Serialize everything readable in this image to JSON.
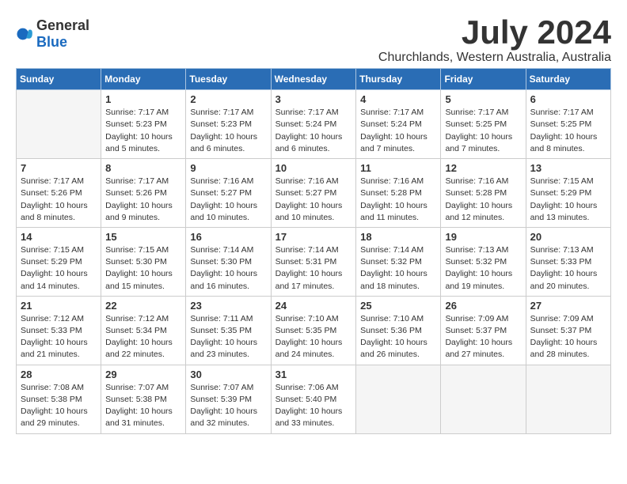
{
  "header": {
    "logo_general": "General",
    "logo_blue": "Blue",
    "title": "July 2024",
    "location": "Churchlands, Western Australia, Australia"
  },
  "weekdays": [
    "Sunday",
    "Monday",
    "Tuesday",
    "Wednesday",
    "Thursday",
    "Friday",
    "Saturday"
  ],
  "weeks": [
    [
      {
        "day": "",
        "info": ""
      },
      {
        "day": "1",
        "info": "Sunrise: 7:17 AM\nSunset: 5:23 PM\nDaylight: 10 hours\nand 5 minutes."
      },
      {
        "day": "2",
        "info": "Sunrise: 7:17 AM\nSunset: 5:23 PM\nDaylight: 10 hours\nand 6 minutes."
      },
      {
        "day": "3",
        "info": "Sunrise: 7:17 AM\nSunset: 5:24 PM\nDaylight: 10 hours\nand 6 minutes."
      },
      {
        "day": "4",
        "info": "Sunrise: 7:17 AM\nSunset: 5:24 PM\nDaylight: 10 hours\nand 7 minutes."
      },
      {
        "day": "5",
        "info": "Sunrise: 7:17 AM\nSunset: 5:25 PM\nDaylight: 10 hours\nand 7 minutes."
      },
      {
        "day": "6",
        "info": "Sunrise: 7:17 AM\nSunset: 5:25 PM\nDaylight: 10 hours\nand 8 minutes."
      }
    ],
    [
      {
        "day": "7",
        "info": "Sunrise: 7:17 AM\nSunset: 5:26 PM\nDaylight: 10 hours\nand 8 minutes."
      },
      {
        "day": "8",
        "info": "Sunrise: 7:17 AM\nSunset: 5:26 PM\nDaylight: 10 hours\nand 9 minutes."
      },
      {
        "day": "9",
        "info": "Sunrise: 7:16 AM\nSunset: 5:27 PM\nDaylight: 10 hours\nand 10 minutes."
      },
      {
        "day": "10",
        "info": "Sunrise: 7:16 AM\nSunset: 5:27 PM\nDaylight: 10 hours\nand 10 minutes."
      },
      {
        "day": "11",
        "info": "Sunrise: 7:16 AM\nSunset: 5:28 PM\nDaylight: 10 hours\nand 11 minutes."
      },
      {
        "day": "12",
        "info": "Sunrise: 7:16 AM\nSunset: 5:28 PM\nDaylight: 10 hours\nand 12 minutes."
      },
      {
        "day": "13",
        "info": "Sunrise: 7:15 AM\nSunset: 5:29 PM\nDaylight: 10 hours\nand 13 minutes."
      }
    ],
    [
      {
        "day": "14",
        "info": "Sunrise: 7:15 AM\nSunset: 5:29 PM\nDaylight: 10 hours\nand 14 minutes."
      },
      {
        "day": "15",
        "info": "Sunrise: 7:15 AM\nSunset: 5:30 PM\nDaylight: 10 hours\nand 15 minutes."
      },
      {
        "day": "16",
        "info": "Sunrise: 7:14 AM\nSunset: 5:30 PM\nDaylight: 10 hours\nand 16 minutes."
      },
      {
        "day": "17",
        "info": "Sunrise: 7:14 AM\nSunset: 5:31 PM\nDaylight: 10 hours\nand 17 minutes."
      },
      {
        "day": "18",
        "info": "Sunrise: 7:14 AM\nSunset: 5:32 PM\nDaylight: 10 hours\nand 18 minutes."
      },
      {
        "day": "19",
        "info": "Sunrise: 7:13 AM\nSunset: 5:32 PM\nDaylight: 10 hours\nand 19 minutes."
      },
      {
        "day": "20",
        "info": "Sunrise: 7:13 AM\nSunset: 5:33 PM\nDaylight: 10 hours\nand 20 minutes."
      }
    ],
    [
      {
        "day": "21",
        "info": "Sunrise: 7:12 AM\nSunset: 5:33 PM\nDaylight: 10 hours\nand 21 minutes."
      },
      {
        "day": "22",
        "info": "Sunrise: 7:12 AM\nSunset: 5:34 PM\nDaylight: 10 hours\nand 22 minutes."
      },
      {
        "day": "23",
        "info": "Sunrise: 7:11 AM\nSunset: 5:35 PM\nDaylight: 10 hours\nand 23 minutes."
      },
      {
        "day": "24",
        "info": "Sunrise: 7:10 AM\nSunset: 5:35 PM\nDaylight: 10 hours\nand 24 minutes."
      },
      {
        "day": "25",
        "info": "Sunrise: 7:10 AM\nSunset: 5:36 PM\nDaylight: 10 hours\nand 26 minutes."
      },
      {
        "day": "26",
        "info": "Sunrise: 7:09 AM\nSunset: 5:37 PM\nDaylight: 10 hours\nand 27 minutes."
      },
      {
        "day": "27",
        "info": "Sunrise: 7:09 AM\nSunset: 5:37 PM\nDaylight: 10 hours\nand 28 minutes."
      }
    ],
    [
      {
        "day": "28",
        "info": "Sunrise: 7:08 AM\nSunset: 5:38 PM\nDaylight: 10 hours\nand 29 minutes."
      },
      {
        "day": "29",
        "info": "Sunrise: 7:07 AM\nSunset: 5:38 PM\nDaylight: 10 hours\nand 31 minutes."
      },
      {
        "day": "30",
        "info": "Sunrise: 7:07 AM\nSunset: 5:39 PM\nDaylight: 10 hours\nand 32 minutes."
      },
      {
        "day": "31",
        "info": "Sunrise: 7:06 AM\nSunset: 5:40 PM\nDaylight: 10 hours\nand 33 minutes."
      },
      {
        "day": "",
        "info": ""
      },
      {
        "day": "",
        "info": ""
      },
      {
        "day": "",
        "info": ""
      }
    ]
  ]
}
